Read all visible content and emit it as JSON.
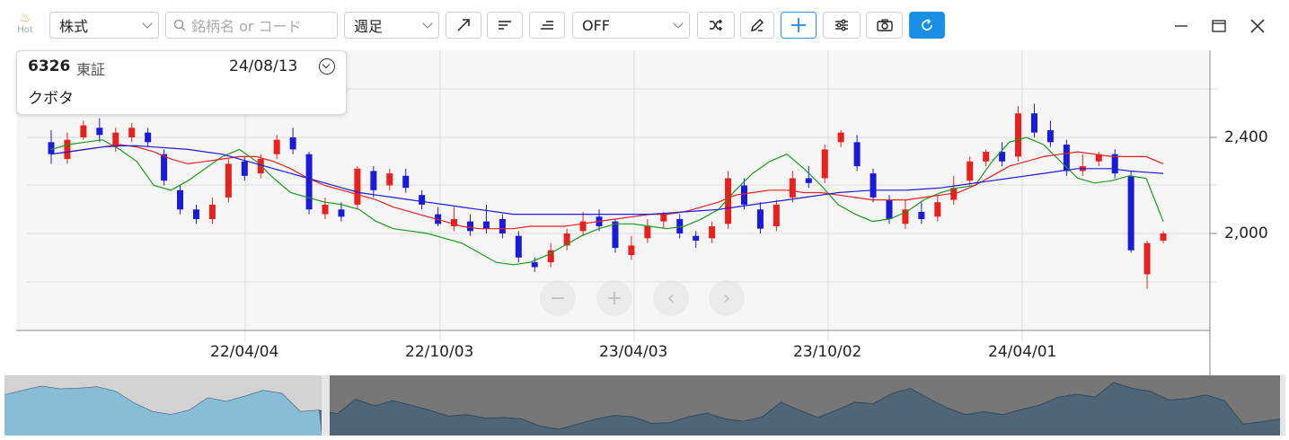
{
  "toolbar": {
    "hot_label": "Hot",
    "market_select": "株式",
    "search_placeholder": "銘柄名 or コード",
    "period_select": "週足",
    "indicator_select": "OFF"
  },
  "info_panel": {
    "code": "6326",
    "market": "東証",
    "date": "24/08/13",
    "name": "クボタ"
  },
  "y_axis": {
    "labels": [
      "2,400",
      "2,000"
    ]
  },
  "x_axis": {
    "labels": [
      "22/04/04",
      "22/10/03",
      "23/04/03",
      "23/10/02",
      "24/04/01"
    ]
  },
  "colors": {
    "up": "#e8201e",
    "down": "#1a1adb",
    "ma_short": "#1a9a1a",
    "ma_mid": "#e82020",
    "ma_long": "#1a1ae0",
    "accent": "#1a8fe6"
  },
  "chart_data": {
    "type": "candlestick",
    "y_range": [
      1740,
      2680
    ],
    "series": [
      {
        "name": "short_ma",
        "values": [
          2350,
          2370,
          2380,
          2390,
          2350,
          2300,
          2200,
          2180,
          2220,
          2270,
          2320,
          2350,
          2300,
          2230,
          2170,
          2150,
          2130,
          2120,
          2100,
          2050,
          2020,
          2010,
          2000,
          1980,
          1960,
          1920,
          1880,
          1870,
          1880,
          1910,
          1950,
          1990,
          2020,
          2040,
          2040,
          2030,
          2020,
          2030,
          2060,
          2100,
          2180,
          2250,
          2300,
          2330,
          2270,
          2200,
          2120,
          2080,
          2050,
          2060,
          2090,
          2140,
          2170,
          2190,
          2200,
          2300,
          2380,
          2400,
          2370,
          2300,
          2230,
          2210,
          2220,
          2240,
          2230,
          2050
        ]
      },
      {
        "name": "mid_ma",
        "values": [
          2330,
          2340,
          2350,
          2360,
          2370,
          2360,
          2340,
          2310,
          2290,
          2300,
          2310,
          2320,
          2320,
          2300,
          2270,
          2230,
          2200,
          2180,
          2160,
          2140,
          2110,
          2090,
          2070,
          2050,
          2030,
          2020,
          2020,
          2020,
          2030,
          2030,
          2030,
          2040,
          2050,
          2060,
          2070,
          2080,
          2080,
          2090,
          2110,
          2130,
          2160,
          2170,
          2180,
          2180,
          2170,
          2170,
          2160,
          2150,
          2140,
          2140,
          2140,
          2150,
          2160,
          2170,
          2200,
          2240,
          2280,
          2300,
          2320,
          2330,
          2340,
          2330,
          2320,
          2320,
          2320,
          2290
        ]
      },
      {
        "name": "long_ma",
        "values": [
          2330,
          2340,
          2350,
          2360,
          2365,
          2365,
          2360,
          2355,
          2350,
          2340,
          2330,
          2310,
          2290,
          2270,
          2250,
          2230,
          2210,
          2190,
          2170,
          2160,
          2150,
          2140,
          2130,
          2120,
          2110,
          2100,
          2090,
          2080,
          2080,
          2080,
          2080,
          2080,
          2080,
          2080,
          2080,
          2080,
          2085,
          2090,
          2095,
          2100,
          2110,
          2120,
          2130,
          2140,
          2150,
          2160,
          2170,
          2175,
          2180,
          2180,
          2180,
          2185,
          2190,
          2200,
          2210,
          2220,
          2230,
          2240,
          2250,
          2260,
          2270,
          2270,
          2270,
          2260,
          2255,
          2250
        ]
      }
    ],
    "candles": [
      [
        2380,
        2330,
        2430,
        2290
      ],
      [
        2310,
        2390,
        2420,
        2290
      ],
      [
        2400,
        2450,
        2470,
        2390
      ],
      [
        2440,
        2410,
        2480,
        2380
      ],
      [
        2360,
        2420,
        2440,
        2340
      ],
      [
        2400,
        2440,
        2460,
        2380
      ],
      [
        2420,
        2380,
        2440,
        2360
      ],
      [
        2330,
        2220,
        2350,
        2200
      ],
      [
        2180,
        2100,
        2200,
        2080
      ],
      [
        2100,
        2060,
        2120,
        2040
      ],
      [
        2060,
        2120,
        2150,
        2040
      ],
      [
        2150,
        2290,
        2310,
        2130
      ],
      [
        2300,
        2240,
        2320,
        2220
      ],
      [
        2250,
        2310,
        2330,
        2230
      ],
      [
        2330,
        2390,
        2410,
        2310
      ],
      [
        2400,
        2350,
        2440,
        2330
      ],
      [
        2330,
        2100,
        2340,
        2080
      ],
      [
        2080,
        2120,
        2150,
        2060
      ],
      [
        2100,
        2070,
        2130,
        2050
      ],
      [
        2120,
        2270,
        2280,
        2100
      ],
      [
        2260,
        2180,
        2280,
        2150
      ],
      [
        2200,
        2250,
        2270,
        2180
      ],
      [
        2240,
        2190,
        2270,
        2170
      ],
      [
        2160,
        2120,
        2180,
        2100
      ],
      [
        2080,
        2040,
        2110,
        2030
      ],
      [
        2030,
        2060,
        2110,
        2010
      ],
      [
        2050,
        2010,
        2080,
        1990
      ],
      [
        2050,
        2020,
        2120,
        2000
      ],
      [
        2060,
        2000,
        2080,
        1980
      ],
      [
        1990,
        1900,
        2010,
        1880
      ],
      [
        1880,
        1860,
        1900,
        1840
      ],
      [
        1880,
        1930,
        1960,
        1860
      ],
      [
        1950,
        2000,
        2020,
        1930
      ],
      [
        2010,
        2050,
        2090,
        1990
      ],
      [
        2070,
        2030,
        2100,
        2010
      ],
      [
        2050,
        1940,
        2060,
        1920
      ],
      [
        1910,
        1950,
        1990,
        1890
      ],
      [
        1980,
        2030,
        2060,
        1960
      ],
      [
        2050,
        2080,
        2090,
        2020
      ],
      [
        2060,
        2000,
        2080,
        1980
      ],
      [
        1990,
        1970,
        2010,
        1940
      ],
      [
        1980,
        2030,
        2050,
        1960
      ],
      [
        2040,
        2230,
        2260,
        2020
      ],
      [
        2200,
        2120,
        2230,
        2100
      ],
      [
        2100,
        2020,
        2130,
        2000
      ],
      [
        2030,
        2120,
        2140,
        2010
      ],
      [
        2150,
        2230,
        2260,
        2130
      ],
      [
        2230,
        2210,
        2280,
        2190
      ],
      [
        2230,
        2350,
        2370,
        2210
      ],
      [
        2380,
        2420,
        2430,
        2360
      ],
      [
        2380,
        2280,
        2410,
        2260
      ],
      [
        2250,
        2150,
        2270,
        2130
      ],
      [
        2140,
        2060,
        2160,
        2040
      ],
      [
        2040,
        2100,
        2140,
        2020
      ],
      [
        2090,
        2060,
        2130,
        2040
      ],
      [
        2070,
        2130,
        2160,
        2050
      ],
      [
        2140,
        2190,
        2240,
        2120
      ],
      [
        2220,
        2300,
        2320,
        2200
      ],
      [
        2300,
        2340,
        2350,
        2280
      ],
      [
        2340,
        2300,
        2380,
        2280
      ],
      [
        2320,
        2500,
        2530,
        2300
      ],
      [
        2500,
        2420,
        2540,
        2400
      ],
      [
        2430,
        2380,
        2470,
        2360
      ],
      [
        2370,
        2260,
        2390,
        2240
      ],
      [
        2260,
        2280,
        2330,
        2240
      ],
      [
        2300,
        2330,
        2340,
        2280
      ],
      [
        2330,
        2250,
        2350,
        2230
      ],
      [
        2240,
        1930,
        2260,
        1920
      ],
      [
        1830,
        1960,
        1970,
        1770
      ],
      [
        1970,
        2000,
        2010,
        1960
      ]
    ]
  }
}
